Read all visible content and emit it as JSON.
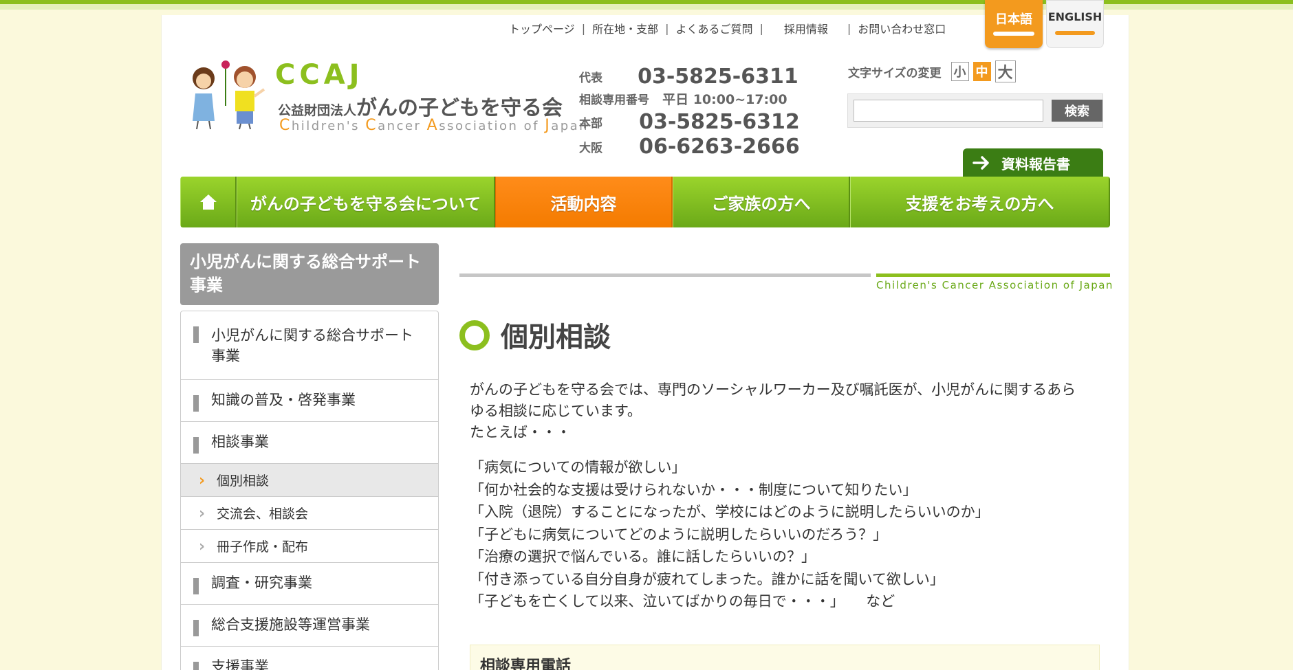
{
  "util_nav": [
    "トップページ",
    "所在地・支部",
    "よくあるご質問",
    "採用情報",
    "お問い合わせ窓口"
  ],
  "lang": {
    "ja": "日本語",
    "en": "ENGLISH"
  },
  "logo": {
    "ccaj": "CCAJ",
    "org_prefix": "公益財団法人",
    "org_name": "がんの子どもを守る会",
    "org_en_parts": [
      "C",
      "hildren's ",
      "C",
      "ancer ",
      "A",
      "ssociation of ",
      "J",
      "apan"
    ]
  },
  "phones": {
    "main_label": "代表",
    "main_number": "03-5825-6311",
    "consult_label": "相談専用番号",
    "consult_hours": "平日 10:00~17:00",
    "hq_label": "本部",
    "hq_number": "03-5825-6312",
    "osaka_label": "大阪",
    "osaka_number": "06-6263-2666"
  },
  "font_size": {
    "label": "文字サイズの変更",
    "small": "小",
    "medium": "中",
    "large": "大",
    "selected": "中"
  },
  "search": {
    "button": "検索",
    "value": ""
  },
  "report_button": "資料報告書",
  "main_nav": {
    "home_icon": "house-icon",
    "items": [
      "がんの子どもを守る会について",
      "活動内容",
      "ご家族の方へ",
      "支援をお考えの方へ"
    ],
    "active": "活動内容"
  },
  "sidebar": {
    "heading": "小児がんに関する総合サポート事業",
    "items": [
      {
        "label": "小児がんに関する総合サポート事業",
        "level": 1
      },
      {
        "label": "知識の普及・啓発事業",
        "level": 1
      },
      {
        "label": "相談事業",
        "level": 1
      },
      {
        "label": "個別相談",
        "level": 2,
        "active": true
      },
      {
        "label": "交流会、相談会",
        "level": 2
      },
      {
        "label": "冊子作成・配布",
        "level": 2
      },
      {
        "label": "調査・研究事業",
        "level": 1
      },
      {
        "label": "総合支援施設等運営事業",
        "level": 1
      },
      {
        "label": "支援事業",
        "level": 1
      }
    ]
  },
  "content": {
    "deco_en": "Children's Cancer Association of Japan",
    "title": "個別相談",
    "intro_lines": [
      "がんの子どもを守る会では、専門のソーシャルワーカー及び嘱託医が、小児がんに関するあら",
      "ゆる相談に応じています。",
      "たとえば・・・"
    ],
    "examples": [
      "「病気についての情報が欲しい」",
      "「何か社会的な支援は受けられないか・・・制度について知りたい」",
      "「入院（退院）することになったが、学校にはどのように説明したらいいのか」",
      "「子どもに病気についてどのように説明したらいいのだろう？」",
      "「治療の選択で悩んでいる。誰に話したらいいの？」",
      "「付き添っている自分自身が疲れてしまった。誰かに話を聞いて欲しい」",
      "「子どもを亡くして以来、泣いてばかりの毎日で・・・」　　など"
    ],
    "phone_section_title": "相談専用電話"
  },
  "colors": {
    "brand_green": "#8cbf1e",
    "accent_orange": "#f39a1e",
    "page_bg": "#fbf9dc"
  }
}
